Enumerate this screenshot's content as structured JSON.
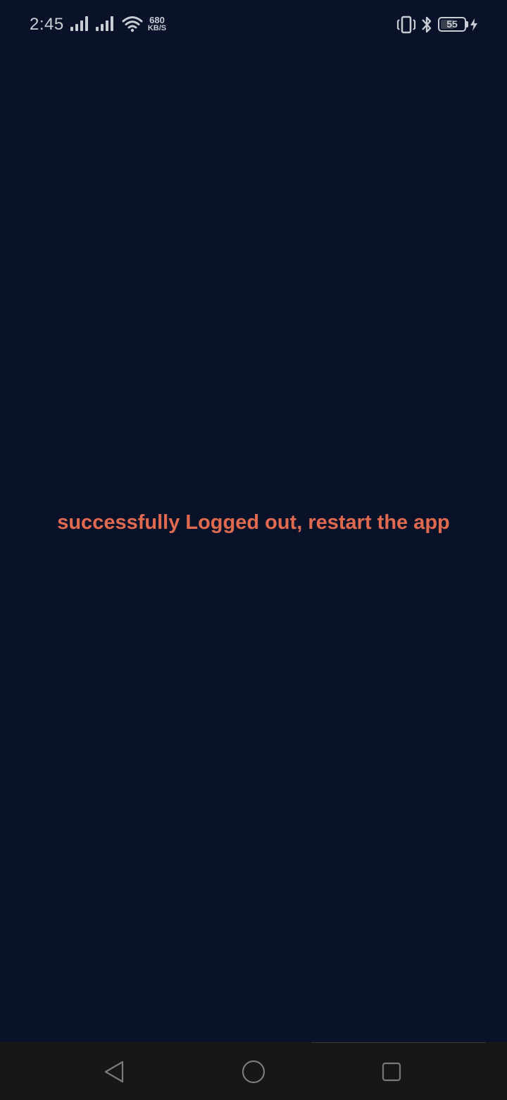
{
  "status_bar": {
    "time": "2:45",
    "network_speed_value": "680",
    "network_speed_unit": "KB/S",
    "battery_percent": "55",
    "battery_level": 0.55,
    "icons": [
      "signal-icon",
      "signal-icon",
      "wifi-icon",
      "vibrate-icon",
      "bluetooth-icon",
      "battery-icon",
      "charging-icon"
    ]
  },
  "main": {
    "message": "successfully Logged out, restart the app",
    "message_color": "#e06a4f",
    "background_color": "#0a122a"
  },
  "nav_bar": {
    "buttons": [
      "back",
      "home",
      "recents"
    ],
    "background_color": "#171717"
  }
}
